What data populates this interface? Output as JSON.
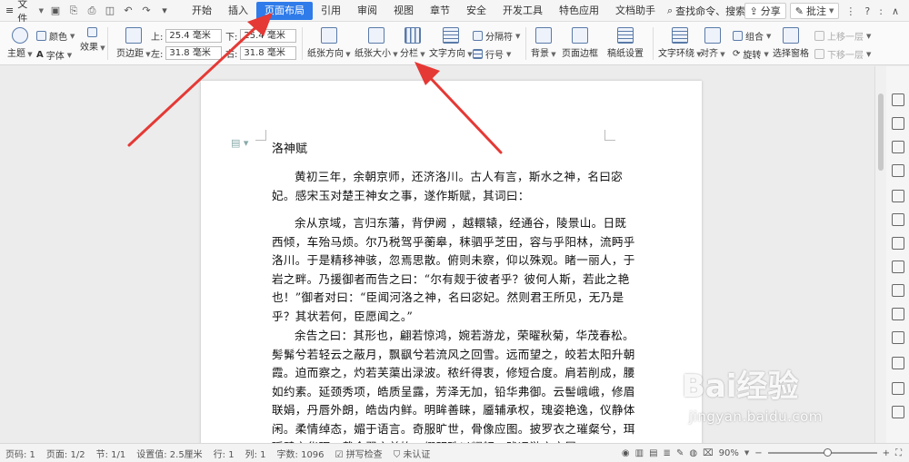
{
  "menubar": {
    "file_menu": "文件",
    "tabs": [
      "开始",
      "插入",
      "页面布局",
      "引用",
      "审阅",
      "视图",
      "章节",
      "安全",
      "开发工具",
      "特色应用",
      "文档助手"
    ],
    "active_tab": "页面布局",
    "search_command": "查找命令、搜索模板",
    "share": "分享",
    "annotate": "批注"
  },
  "ribbon": {
    "theme": "主题",
    "color": "颜色",
    "font": "字体",
    "effect": "效果",
    "margin": "页边距",
    "top_label": "上:",
    "top_value": "25.4 毫米",
    "bottom_label": "下:",
    "bottom_value": "25.4 毫米",
    "left_label": "左:",
    "left_value": "31.8 毫米",
    "right_label": "右:",
    "right_value": "31.8 毫米",
    "orientation": "纸张方向",
    "paper_size": "纸张大小",
    "columns": "分栏",
    "text_direction": "文字方向",
    "separator": "分隔符",
    "line_number": "行号",
    "background": "背景",
    "page_border": "页面边框",
    "manuscript": "稿纸设置",
    "text_wrap": "文字环绕",
    "align": "对齐",
    "rotate": "旋转",
    "group": "组合",
    "selection_pane": "选择窗格",
    "bring_forward": "上移一层",
    "send_backward": "下移一层"
  },
  "document": {
    "title": "洛神赋",
    "paragraphs": [
      "黄初三年，余朝京师，还济洛川。古人有言，斯水之神，名曰宓妃。感宋玉对楚王神女之事，遂作斯赋，其词曰：",
      "余从京域，言归东藩，背伊阙 ，越轘辕，经通谷，陵景山。日既西倾，车殆马烦。尔乃税驾乎蘅皋，秣驷乎芝田，容与乎阳林，流眄乎洛川。于是精移神骇，忽焉思散。俯则未察，仰以殊观。睹一丽人，于岩之畔。乃援御者而告之曰：“尔有觌于彼者乎？彼何人斯，若此之艳也！”御者对曰：“臣闻河洛之神，名曰宓妃。然则君王所见，无乃是乎？其状若何，臣愿闻之。”",
      "余告之曰：其形也，翩若惊鸿，婉若游龙，荣曜秋菊，华茂春松。髣髴兮若轻云之蔽月，飘飖兮若流风之回雪。远而望之，皎若太阳升朝霞。迫而察之，灼若芙蕖出渌波。秾纤得衷，修短合度。肩若削成，腰如约素。延颈秀项，皓质呈露，芳泽无加，铅华弗御。云髻峨峨，修眉联娟，丹唇外朗，皓齿内鲜。明眸善睐，靥辅承权，瑰姿艳逸，仪静体闲。柔情绰态，媚于语言。奇服旷世，骨像应图。披罗衣之璀粲兮，珥瑶碧之华琚。戴金翠之首饰，缀明珠以耀躯。践远游之文履，"
    ]
  },
  "statusbar": {
    "page_num": "页码: 1",
    "pages": "页面: 1/2",
    "section": "节: 1/1",
    "setting": "设置值: 2.5厘米",
    "row": "行: 1",
    "col": "列: 1",
    "words": "字数: 1096",
    "spellcheck": "拼写检查",
    "auth": "未认证",
    "zoom": "90%",
    "zoom_level": 0.55
  },
  "watermark": {
    "brand": "Bai经验",
    "url": "jingyan.baidu.com"
  },
  "colors": {
    "accent": "#2f7bea",
    "arrow": "#e53935"
  }
}
